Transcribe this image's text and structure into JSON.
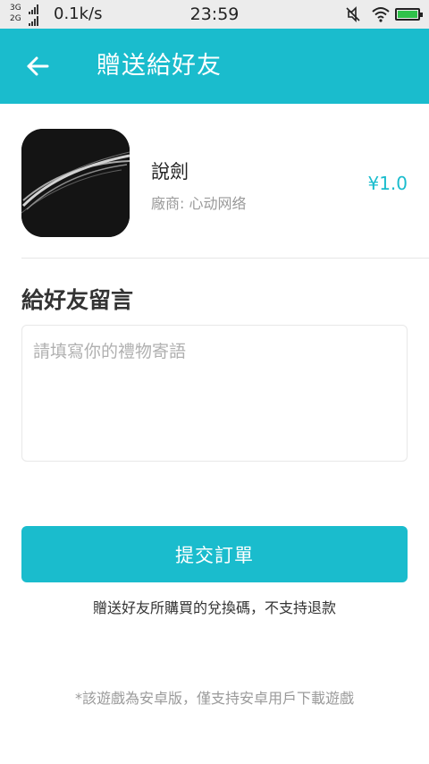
{
  "status_bar": {
    "network_top": "3G",
    "network_bottom": "2G",
    "speed": "0.1k/s",
    "time": "23:59",
    "icons": [
      "signal-icon",
      "mute-icon",
      "wifi-icon",
      "battery-icon"
    ],
    "battery_color": "#2fc24a"
  },
  "app_bar": {
    "title": "贈送給好友",
    "back_icon": "arrow-left-icon",
    "background_color": "#1abccd"
  },
  "product": {
    "name": "說劍",
    "vendor": "廠商: 心动网络",
    "price": "¥1.0"
  },
  "message": {
    "title": "給好友留言",
    "placeholder": "請填寫你的禮物寄語",
    "value": ""
  },
  "submit": {
    "label": "提交訂單"
  },
  "notice": "贈送好友所購買的兌換碼，不支持退款",
  "footnote": "*該遊戲為安卓版，僅支持安卓用戶下載遊戲"
}
